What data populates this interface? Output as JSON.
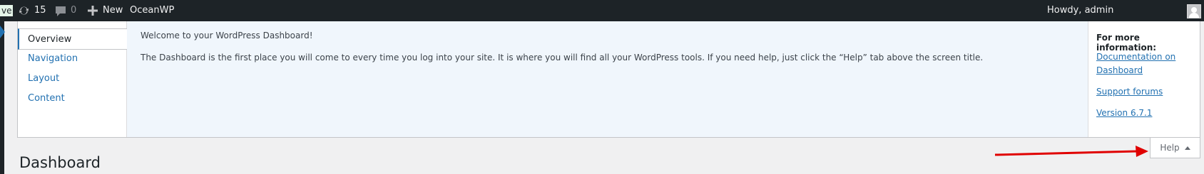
{
  "adminbar": {
    "live_badge": "ve",
    "updates_count": "15",
    "comments_count": "0",
    "new_label": "New",
    "site_name": "OceanWP",
    "greeting": "Howdy, admin",
    "icons": [
      "updates-icon",
      "comments-icon",
      "plus-icon",
      "avatar"
    ]
  },
  "help": {
    "tabs": [
      "Overview",
      "Navigation",
      "Layout",
      "Content"
    ],
    "active_tab": "Overview",
    "content": {
      "title": "Welcome to your WordPress Dashboard!",
      "body": "The Dashboard is the first place you will come to every time you log into your site. It is where you will find all your WordPress tools. If you need help, just click the “Help” tab above the screen title."
    },
    "sidebar": {
      "heading": "For more information:",
      "link1_line1": "Documentation on",
      "link1_line2": "Dashboard",
      "link2": "Support forums",
      "link3": "Version 6.7.1"
    },
    "toggle_label": "Help"
  },
  "page": {
    "title": "Dashboard"
  },
  "colors": {
    "accent": "#2271b1",
    "adminbar": "#1d2327",
    "annotation_arrow": "#e00000"
  }
}
